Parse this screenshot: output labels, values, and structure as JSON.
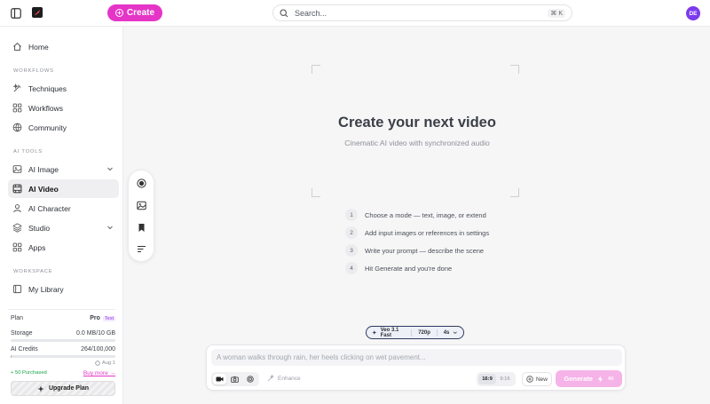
{
  "topbar": {
    "create_label": "Create",
    "search_placeholder": "Search...",
    "search_shortcut": "⌘ K",
    "avatar_initials": "DE",
    "brand_color": "#e535c7",
    "avatar_color": "#7c3aed"
  },
  "sidebar": {
    "home": "Home",
    "workflows_section": "WORKFLOWS",
    "workflow_items": [
      "Techniques",
      "Workflows",
      "Community"
    ],
    "ai_tools_section": "AI TOOLS",
    "tool_items": [
      "AI Image",
      "AI Video",
      "AI Character",
      "Studio",
      "Apps"
    ],
    "active_item": "AI Video",
    "workspace_section": "WORKSPACE",
    "library": "My Library"
  },
  "plan": {
    "plan_label": "Plan",
    "plan_name": "Pro",
    "plan_badge": "Test",
    "storage_label": "Storage",
    "storage_value": "0.0 MB/10 GB",
    "storage_fraction": 0.0,
    "credits_label": "AI Credits",
    "credits_value": "264/100,000",
    "credits_fraction": 0.00264,
    "renew_date": "Aug 1",
    "purchased_text": "+ 50 Purchased",
    "buy_more": "Buy more →",
    "upgrade_label": "Upgrade Plan"
  },
  "hero": {
    "title": "Create your next video",
    "subtitle": "Cinematic AI video with synchronized audio",
    "steps": [
      {
        "num": "1",
        "text": "Choose a mode — text, image, or extend"
      },
      {
        "num": "2",
        "text": "Add input images or references in settings"
      },
      {
        "num": "3",
        "text": "Write your prompt — describe the scene"
      },
      {
        "num": "4",
        "text": "Hit Generate and you're done"
      }
    ]
  },
  "model": {
    "name": "Veo 3.1 Fast",
    "resolution": "720p",
    "duration": "4s"
  },
  "composer": {
    "prompt_placeholder": "A woman walks through rain, her heels clicking on wet pavement...",
    "enhance_label": "Enhance",
    "ratios": [
      "16:9",
      "9:16"
    ],
    "active_ratio": "16:9",
    "new_label": "New",
    "generate_label": "Generate",
    "generate_cost": "40"
  }
}
